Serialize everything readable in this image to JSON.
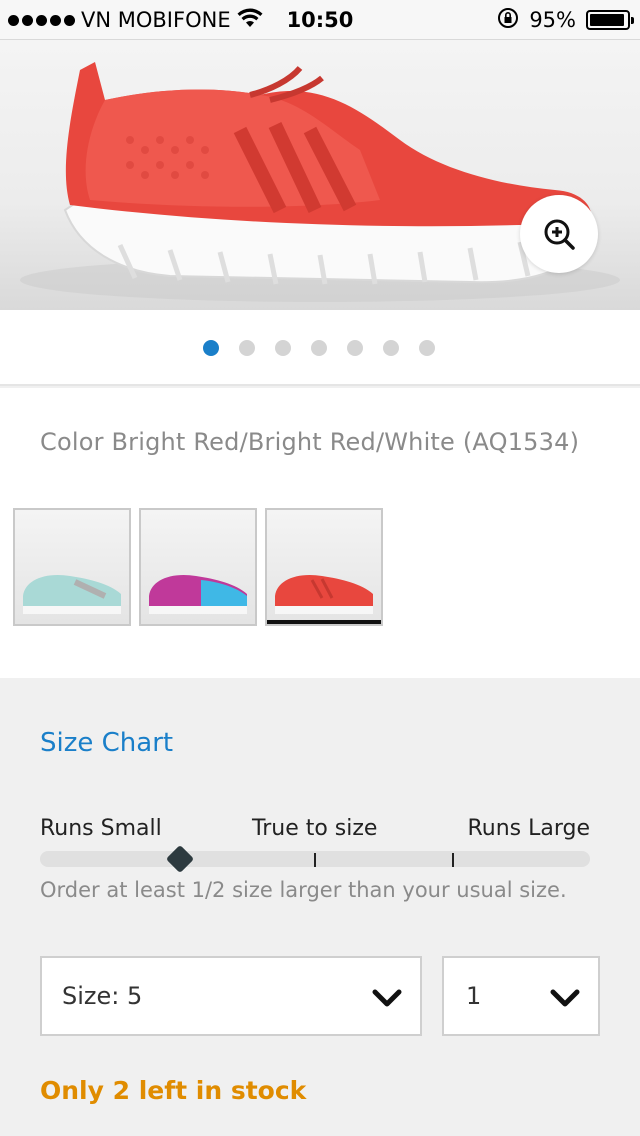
{
  "status_bar": {
    "carrier": "VN MOBIFONE",
    "time": "10:50",
    "battery_text": "95%",
    "battery_level": 0.95
  },
  "gallery": {
    "dot_count": 7,
    "active_index": 0,
    "zoom_icon": "zoom-in-icon"
  },
  "product": {
    "color_text": "Color Bright Red/Bright Red/White (AQ1534)",
    "swatches": [
      {
        "name": "mint",
        "color": "#a9d9d6",
        "selected": false
      },
      {
        "name": "pink-blue",
        "color": "#c0399a",
        "selected": false
      },
      {
        "name": "red",
        "color": "#e8473e",
        "selected": true
      }
    ]
  },
  "sizing": {
    "size_chart_label": "Size Chart",
    "fit_labels": {
      "small": "Runs Small",
      "true": "True to size",
      "large": "Runs Large"
    },
    "fit_position_fraction": 0.255,
    "fit_note": "Order at least 1/2 size larger than your usual size.",
    "size_select_value": "Size: 5",
    "qty_select_value": "1",
    "stock_message": "Only 2 left in stock"
  },
  "colors": {
    "accent": "#1a7fc9",
    "stock_warning": "#e08c00",
    "shoe_red": "#e8473e"
  }
}
